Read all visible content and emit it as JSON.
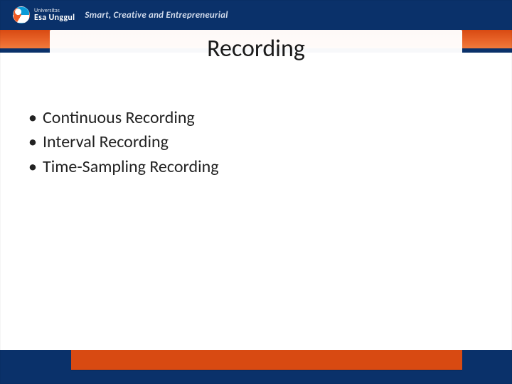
{
  "header": {
    "university_small": "Universitas",
    "university_big": "Esa Unggul",
    "tagline": "Smart, Creative and Entrepreneurial"
  },
  "slide": {
    "title": "Recording",
    "bullets": [
      "Continuous Recording",
      "Interval Recording",
      "Time-Sampling Recording"
    ]
  }
}
